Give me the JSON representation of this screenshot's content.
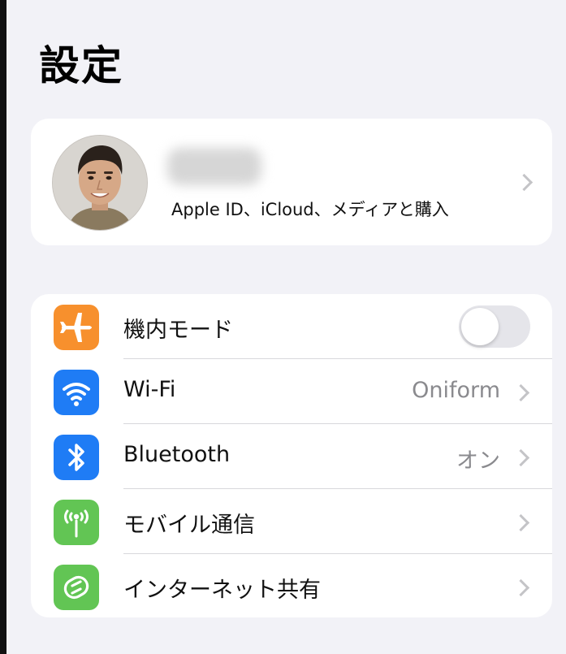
{
  "page": {
    "title": "設定"
  },
  "profile": {
    "name": "●●●●●",
    "subtitle": "Apple ID、iCloud、メディアと購入"
  },
  "settings": {
    "rows": [
      {
        "label": "機内モード",
        "icon": "airplane-icon",
        "color": "#f7902d",
        "control": "toggle",
        "toggle_on": false
      },
      {
        "label": "Wi-Fi",
        "icon": "wifi-icon",
        "color": "#1f7cf5",
        "value": "Oniform"
      },
      {
        "label": "Bluetooth",
        "icon": "bluetooth-icon",
        "color": "#1f7cf5",
        "value": "オン"
      },
      {
        "label": "モバイル通信",
        "icon": "antenna-icon",
        "color": "#62c554"
      },
      {
        "label": "インターネット共有",
        "icon": "hotspot-link-icon",
        "color": "#62c554"
      }
    ]
  },
  "colors": {
    "background": "#f2f2f7",
    "card": "#ffffff",
    "chevron": "#c4c4c7",
    "secondary_text": "#8a8a8e"
  }
}
